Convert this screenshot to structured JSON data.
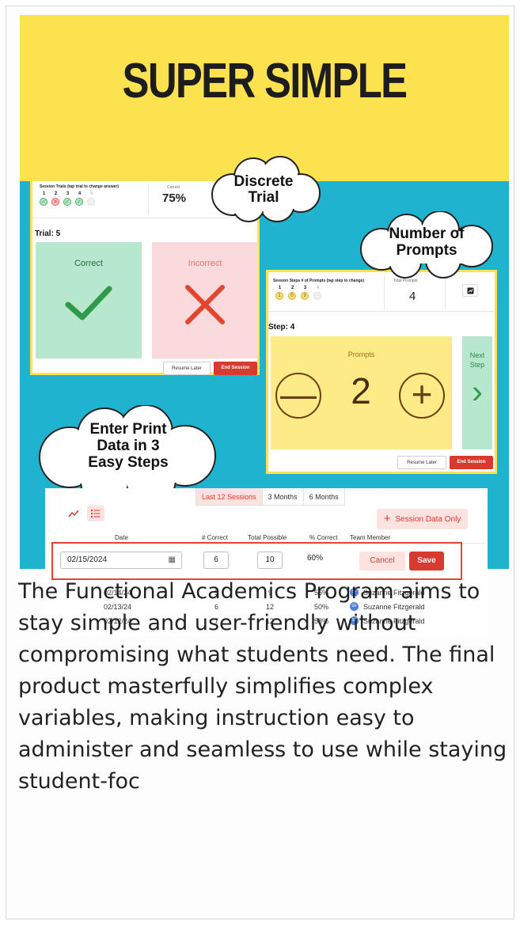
{
  "hero": {
    "title": "SUPER SIMPLE"
  },
  "callouts": {
    "discrete_trial": [
      "Discrete",
      "Trial"
    ],
    "number_of_prompts": [
      "Number of",
      "Prompts"
    ],
    "enter_print": [
      "Enter Print",
      "Data in 3",
      "Easy Steps"
    ]
  },
  "discrete_trial_panel": {
    "session_label": "Session Trials (tap trial to change answer)",
    "trials": [
      {
        "num": "1",
        "result": "correct"
      },
      {
        "num": "2",
        "result": "incorrect"
      },
      {
        "num": "3",
        "result": "correct"
      },
      {
        "num": "4",
        "result": "correct"
      },
      {
        "num": "5",
        "result": "pending"
      }
    ],
    "correct_label": "Correct",
    "correct_value": "75%",
    "trial_title": "Trial: 5",
    "correct_card_label": "Correct",
    "incorrect_card_label": "Incorrect",
    "resume_label": "Resume Later",
    "end_label": "End Session"
  },
  "prompts_panel": {
    "session_label": "Session Steps # of Prompts (tap step to change)",
    "steps": [
      {
        "num": "1",
        "value": "1"
      },
      {
        "num": "2",
        "value": "0"
      },
      {
        "num": "3",
        "value": "3"
      },
      {
        "num": "4",
        "value": ""
      }
    ],
    "total_label": "Total Prompts",
    "total_value": "4",
    "chart_icon": "chart-icon",
    "step_title": "Step: 4",
    "prompts_label": "Prompts",
    "prompt_count": "2",
    "minus_symbol": "—",
    "plus_symbol": "+",
    "next_label": "Next Step",
    "resume_label": "Resume Later",
    "end_label": "End Session"
  },
  "data_table": {
    "tabs": [
      "Last 12 Sessions",
      "3 Months",
      "6 Months"
    ],
    "active_tab": "Last 12 Sessions",
    "session_only_label": "Session Data Only",
    "columns": [
      "Date",
      "# Correct",
      "Total Possible",
      "% Correct",
      "Team Member"
    ],
    "edit_row": {
      "date": "02/15/2024",
      "correct": "6",
      "total": "10",
      "percent": "60%",
      "cancel_label": "Cancel",
      "save_label": "Save"
    },
    "rows": [
      {
        "date": "02/14/24",
        "correct": "5",
        "total": "9",
        "percent": "56%",
        "initials": "SF",
        "member": "Suzanne Fitzgerald"
      },
      {
        "date": "02/13/24",
        "correct": "6",
        "total": "12",
        "percent": "50%",
        "initials": "SF",
        "member": "Suzanne Fitzgerald"
      },
      {
        "date": "02/12/24",
        "correct": "7",
        "total": "12",
        "percent": "58%",
        "initials": "SF",
        "member": "Suzanne Fitzgerald"
      }
    ]
  },
  "caption": "The Functional Academics Program aims to stay simple and user-friendly without compromising what students need. The final product masterfully simplifies complex variables, making instruction easy to administer and seamless to use while staying student-foc",
  "colors": {
    "yellow": "#fde24f",
    "teal": "#1fb3cf",
    "accent_red": "#d93a2f",
    "correct_green": "#b7e7cc",
    "incorrect_pink": "#fadada"
  }
}
